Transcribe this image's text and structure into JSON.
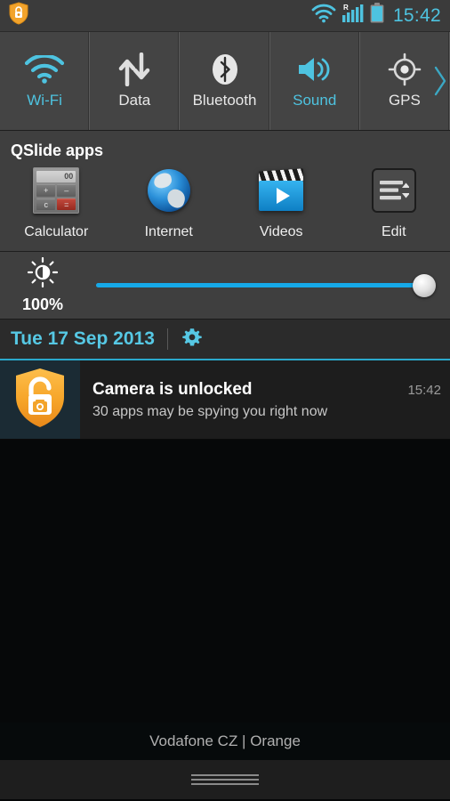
{
  "status_bar": {
    "left_icons": [
      {
        "name": "shield-lock-icon",
        "label": "shield lock"
      }
    ],
    "right_icons": [
      {
        "name": "wifi-icon",
        "label": "wifi"
      },
      {
        "name": "signal-roaming-icon",
        "label": "signal roaming",
        "badge": "R"
      },
      {
        "name": "battery-icon",
        "label": "battery"
      }
    ],
    "time": "15:42"
  },
  "toggles": [
    {
      "label": "Wi-Fi",
      "icon": "wifi-icon",
      "state": "on"
    },
    {
      "label": "Data",
      "icon": "data-arrows-icon",
      "state": "off"
    },
    {
      "label": "Bluetooth",
      "icon": "bluetooth-icon",
      "state": "off"
    },
    {
      "label": "Sound",
      "icon": "sound-speaker-icon",
      "state": "on"
    },
    {
      "label": "GPS",
      "icon": "gps-crosshair-icon",
      "state": "off"
    }
  ],
  "toggles_more_icon": "chevron-right-icon",
  "qslide": {
    "title": "QSlide apps",
    "apps": [
      {
        "label": "Calculator",
        "icon": "calculator-icon",
        "display": "00",
        "keys": [
          "+",
          "–",
          "c",
          "="
        ]
      },
      {
        "label": "Internet",
        "icon": "globe-icon"
      },
      {
        "label": "Videos",
        "icon": "video-clapper-icon"
      },
      {
        "label": "Edit",
        "icon": "edit-list-icon"
      }
    ]
  },
  "brightness": {
    "icon": "brightness-sun-icon",
    "percent": "100%",
    "value": 100
  },
  "date_bar": {
    "date": "Tue 17 Sep 2013",
    "settings_icon": "gear-icon"
  },
  "notifications": [
    {
      "icon": "shield-camera-unlocked-icon",
      "title": "Camera is unlocked",
      "text": "30 apps may be spying you right now",
      "time": "15:42"
    }
  ],
  "carrier": "Vodafone CZ | Orange",
  "handle": {
    "icon": "drag-handle-icon"
  },
  "colors": {
    "accent_cyan": "#4ec3e0",
    "slider_blue": "#16a9e8",
    "shield_gold": "#f5a623",
    "panel_gray": "#444444",
    "status_gray": "#3b3b3b"
  }
}
